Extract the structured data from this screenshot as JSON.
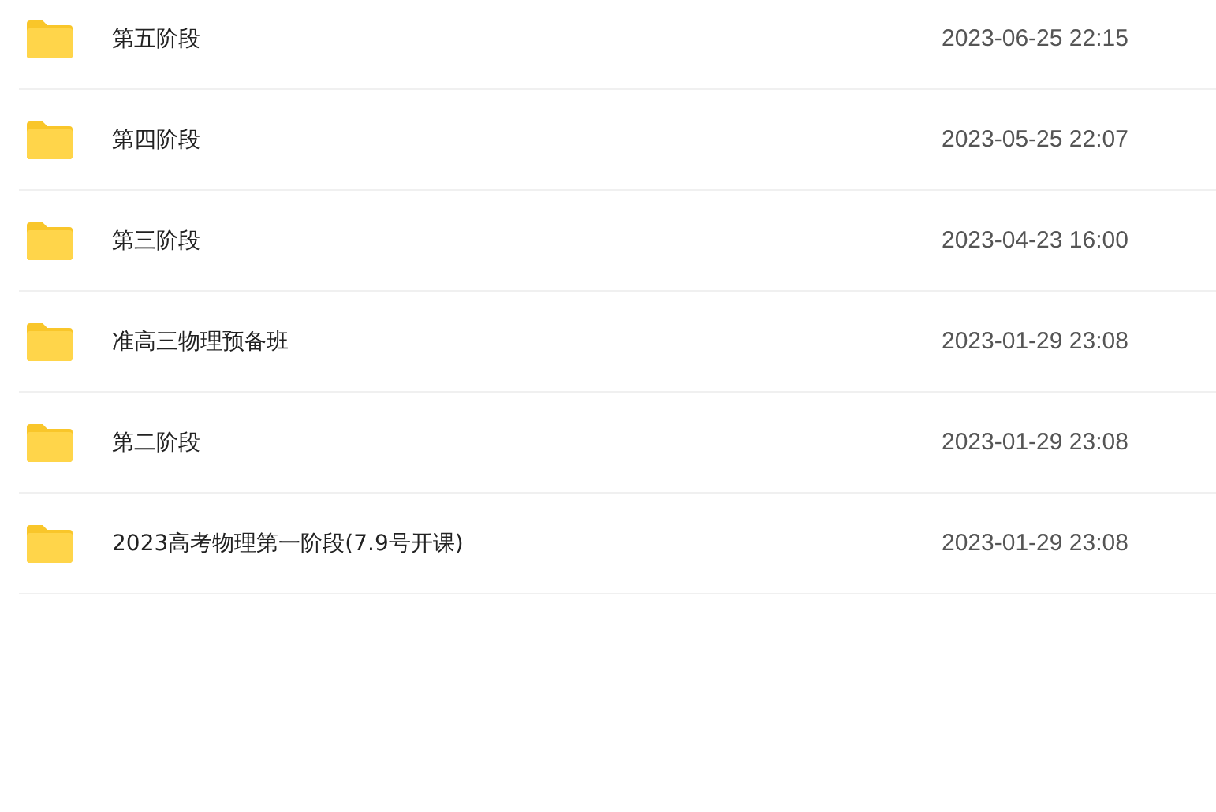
{
  "files": [
    {
      "name": "第五阶段",
      "modified": "2023-06-25 22:15"
    },
    {
      "name": "第四阶段",
      "modified": "2023-05-25 22:07"
    },
    {
      "name": "第三阶段",
      "modified": "2023-04-23 16:00"
    },
    {
      "name": "准高三物理预备班",
      "modified": "2023-01-29 23:08"
    },
    {
      "name": "第二阶段",
      "modified": "2023-01-29 23:08"
    },
    {
      "name": "2023高考物理第一阶段(7.9号开课)",
      "modified": "2023-01-29 23:08"
    }
  ]
}
